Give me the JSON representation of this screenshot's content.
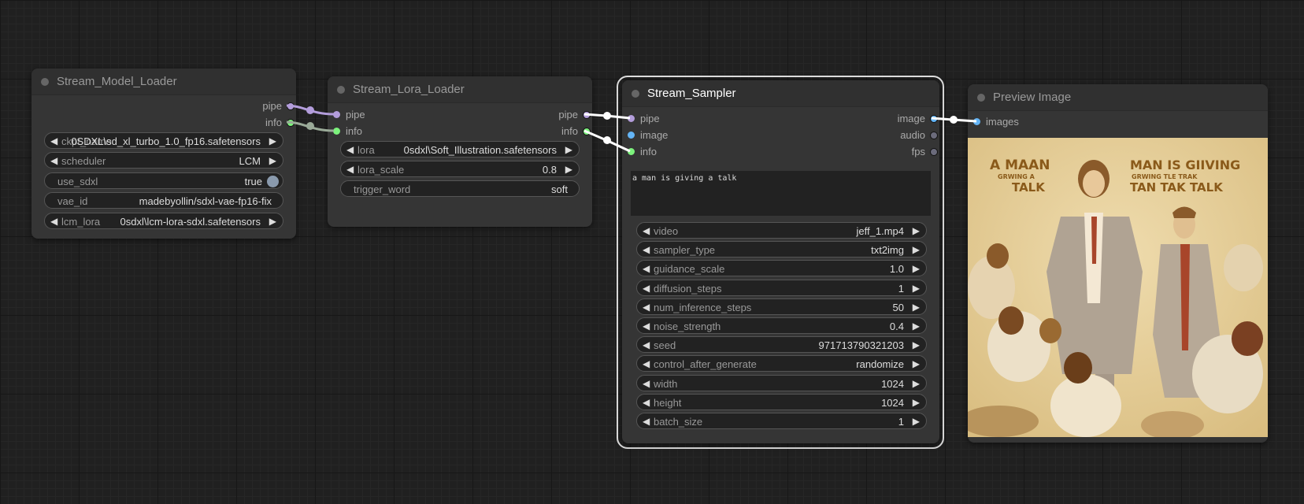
{
  "colors": {
    "pipe": "#b39ddb",
    "info": "#7cf27c",
    "image": "#64b5f6",
    "audio": "#6b6b7b",
    "fps": "#6b6b7b",
    "link_pipe_1": "#b39ddb",
    "link_info_1": "#9aaa98",
    "link_selected": "#ffffff"
  },
  "nodes": {
    "model_loader": {
      "title": "Stream_Model_Loader",
      "outputs": [
        "pipe",
        "info"
      ],
      "widgets": [
        {
          "label": "ckpt_name",
          "value": "0SDXL\\sd_xl_turbo_1.0_fp16.safetensors",
          "type": "combo"
        },
        {
          "label": "scheduler",
          "value": "LCM",
          "type": "combo"
        },
        {
          "label": "use_sdxl",
          "value": "true",
          "type": "toggle"
        },
        {
          "label": "vae_id",
          "value": "madebyollin/sdxl-vae-fp16-fix",
          "type": "text"
        },
        {
          "label": "lcm_lora",
          "value": "0sdxl\\lcm-lora-sdxl.safetensors",
          "type": "combo"
        }
      ]
    },
    "lora_loader": {
      "title": "Stream_Lora_Loader",
      "inputs": [
        "pipe",
        "info"
      ],
      "outputs": [
        "pipe",
        "info"
      ],
      "widgets": [
        {
          "label": "lora",
          "value": "0sdxl\\Soft_Illustration.safetensors",
          "type": "combo"
        },
        {
          "label": "lora_scale",
          "value": "0.8",
          "type": "number"
        },
        {
          "label": "trigger_word",
          "value": "soft",
          "type": "text"
        }
      ]
    },
    "sampler": {
      "title": "Stream_Sampler",
      "inputs": [
        "pipe",
        "image",
        "info"
      ],
      "outputs": [
        "image",
        "audio",
        "fps"
      ],
      "prompt": "a man is giving a talk",
      "widgets": [
        {
          "label": "video",
          "value": "jeff_1.mp4"
        },
        {
          "label": "sampler_type",
          "value": "txt2img"
        },
        {
          "label": "guidance_scale",
          "value": "1.0"
        },
        {
          "label": "diffusion_steps",
          "value": "1"
        },
        {
          "label": "num_inference_steps",
          "value": "50"
        },
        {
          "label": "noise_strength",
          "value": "0.4"
        },
        {
          "label": "seed",
          "value": "971713790321203"
        },
        {
          "label": "control_after_generate",
          "value": "randomize"
        },
        {
          "label": "width",
          "value": "1024"
        },
        {
          "label": "height",
          "value": "1024"
        },
        {
          "label": "batch_size",
          "value": "1"
        }
      ]
    },
    "preview": {
      "title": "Preview Image",
      "inputs": [
        "images"
      ],
      "image": {
        "caption_left": [
          "A  MAAN",
          "GRWING A",
          "TALK"
        ],
        "caption_right": [
          "MAN IS GIIVING",
          "GRWING TLE TRAK",
          "TAN TAK TALK"
        ]
      }
    }
  },
  "icons": {
    "arrow_left": "◀",
    "arrow_right": "▶"
  }
}
